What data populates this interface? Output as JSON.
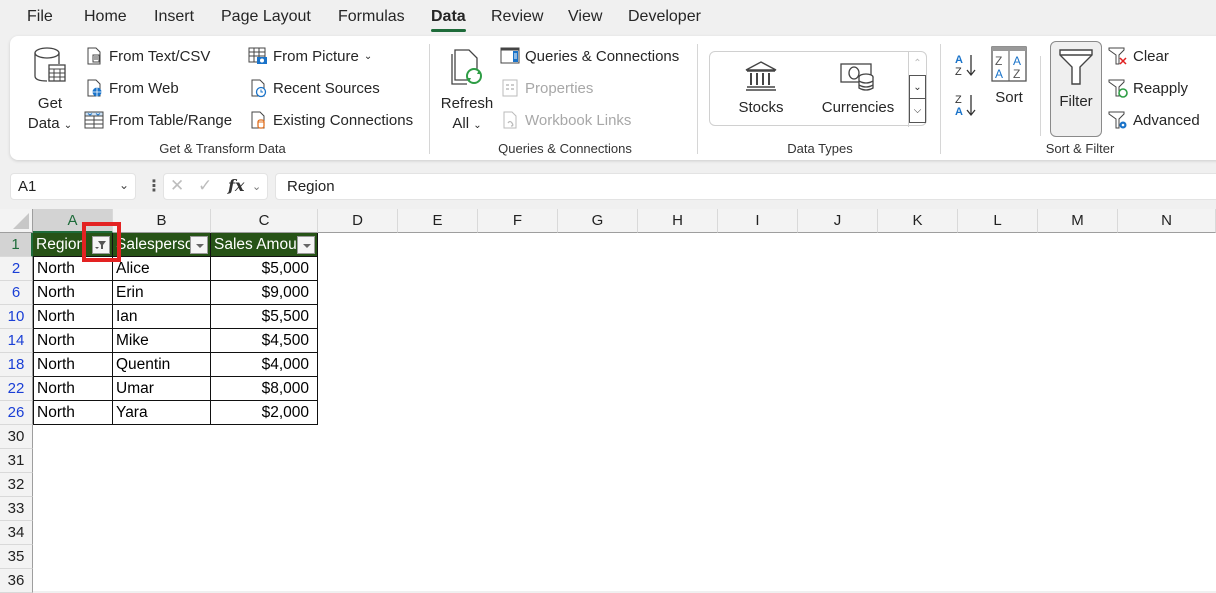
{
  "menu": {
    "tabs": [
      "File",
      "Home",
      "Insert",
      "Page Layout",
      "Formulas",
      "Data",
      "Review",
      "View",
      "Developer"
    ],
    "active": "Data"
  },
  "ribbon": {
    "get_transform": {
      "label": "Get & Transform Data",
      "get_data_line1": "Get",
      "get_data_line2": "Data",
      "from_text_csv": "From Text/CSV",
      "from_web": "From Web",
      "from_table_range": "From Table/Range",
      "from_picture": "From Picture",
      "recent_sources": "Recent Sources",
      "existing_connections": "Existing Connections"
    },
    "queries": {
      "label": "Queries & Connections",
      "refresh_line1": "Refresh",
      "refresh_line2": "All",
      "queries_connections": "Queries & Connections",
      "properties": "Properties",
      "workbook_links": "Workbook Links"
    },
    "data_types": {
      "label": "Data Types",
      "stocks": "Stocks",
      "currencies": "Currencies"
    },
    "sort_filter": {
      "label": "Sort & Filter",
      "sort": "Sort",
      "filter": "Filter",
      "clear": "Clear",
      "reapply": "Reapply",
      "advanced": "Advanced"
    }
  },
  "formula_bar": {
    "name_box": "A1",
    "fx": "fx",
    "formula": "Region"
  },
  "sheet": {
    "columns": [
      "A",
      "B",
      "C",
      "D",
      "E",
      "F",
      "G",
      "H",
      "I",
      "J",
      "K",
      "L",
      "M",
      "N"
    ],
    "headers": [
      "Region",
      "Salesperson",
      "Sales Amount"
    ],
    "header_row": "1",
    "rows": [
      {
        "row": "2",
        "region": "North",
        "salesperson": "Alice",
        "amount": "$5,000"
      },
      {
        "row": "6",
        "region": "North",
        "salesperson": "Erin",
        "amount": "$9,000"
      },
      {
        "row": "10",
        "region": "North",
        "salesperson": "Ian",
        "amount": "$5,500"
      },
      {
        "row": "14",
        "region": "North",
        "salesperson": "Mike",
        "amount": "$4,500"
      },
      {
        "row": "18",
        "region": "North",
        "salesperson": "Quentin",
        "amount": "$4,000"
      },
      {
        "row": "22",
        "region": "North",
        "salesperson": "Umar",
        "amount": "$8,000"
      },
      {
        "row": "26",
        "region": "North",
        "salesperson": "Yara",
        "amount": "$2,000"
      }
    ],
    "empty_rows": [
      "30",
      "31",
      "32",
      "33",
      "34",
      "35",
      "36"
    ]
  },
  "colors": {
    "accent": "#1e6b3a",
    "header_fill": "#275317",
    "filtered_row_number": "#1a3fd6",
    "highlight": "#e32222"
  }
}
